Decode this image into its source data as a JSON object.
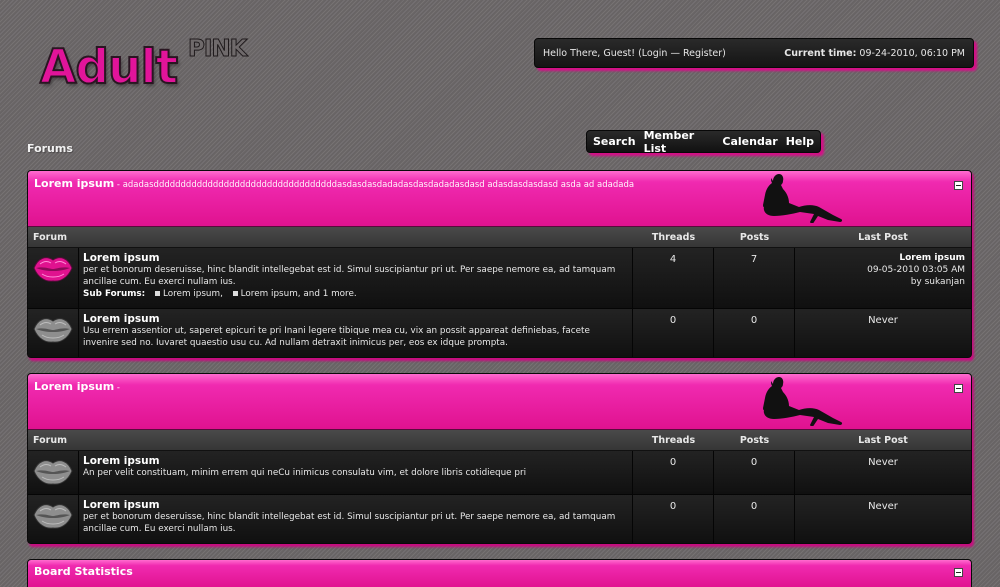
{
  "logo": {
    "main": "Adult",
    "sub": "PINK"
  },
  "header": {
    "greeting": "Hello There, Guest! (",
    "login": "Login",
    "sep": " — ",
    "register": "Register",
    "close": ")",
    "time_label": "Current time:",
    "time_value": " 09-24-2010, 06:10 PM"
  },
  "breadcrumb": "Forums",
  "nav": [
    "Search",
    "Member List",
    "Calendar",
    "Help"
  ],
  "columns": {
    "forum": "Forum",
    "threads": "Threads",
    "posts": "Posts",
    "last_post": "Last Post"
  },
  "categories": [
    {
      "name": "Lorem ipsum",
      "desc": " - adadasddddddddddddddddddddddddddddddddddasdasdasdadadasdasdadadasdasd adasdasdasdasd asda ad adadada",
      "forums": [
        {
          "title": "Lorem ipsum",
          "desc": "per et bonorum deseruisse, hinc blandit intellegebat est id. Simul suscipiantur pri ut. Per saepe nemore ea, ad tamquam ancillae cum. Eu exerci nullam ius.",
          "subforums_label": "Sub Forums:",
          "subforum1": "Lorem ipsum,",
          "subforum2": "Lorem ipsum, and 1 more.",
          "threads": "4",
          "posts": "7",
          "last_title": "Lorem ipsum",
          "last_date": "09-05-2010 03:05 AM",
          "last_by": "by sukanjan",
          "icon": "lips-pink-icon"
        },
        {
          "title": "Lorem ipsum",
          "desc": "Usu errem assentior ut, saperet epicuri te pri Inani legere tibique mea cu, vix an possit appareat definiebas, facete invenire sed no. Iuvaret quaestio usu cu. Ad nullam detraxit inimicus per, eos ex idque prompta.",
          "threads": "0",
          "posts": "0",
          "last": "Never",
          "icon": "lips-gray-icon"
        }
      ]
    },
    {
      "name": "Lorem ipsum",
      "desc": " -",
      "forums": [
        {
          "title": "Lorem ipsum",
          "desc": "An per velit constituam, minim errem qui neCu inimicus consulatu vim, et dolore libris cotidieque pri",
          "threads": "0",
          "posts": "0",
          "last": "Never",
          "icon": "lips-gray-icon"
        },
        {
          "title": "Lorem ipsum",
          "desc": "per et bonorum deseruisse, hinc blandit intellegebat est id. Simul suscipiantur pri ut. Per saepe nemore ea, ad tamquam ancillae cum. Eu exerci nullam ius.",
          "threads": "0",
          "posts": "0",
          "last": "Never",
          "icon": "lips-gray-icon"
        }
      ]
    }
  ],
  "board_stats": "Board Statistics",
  "colors": {
    "accent": "#e0128f",
    "accent_light": "#ff6ccf",
    "background": "#6f6a6b",
    "panel": "#151515"
  }
}
